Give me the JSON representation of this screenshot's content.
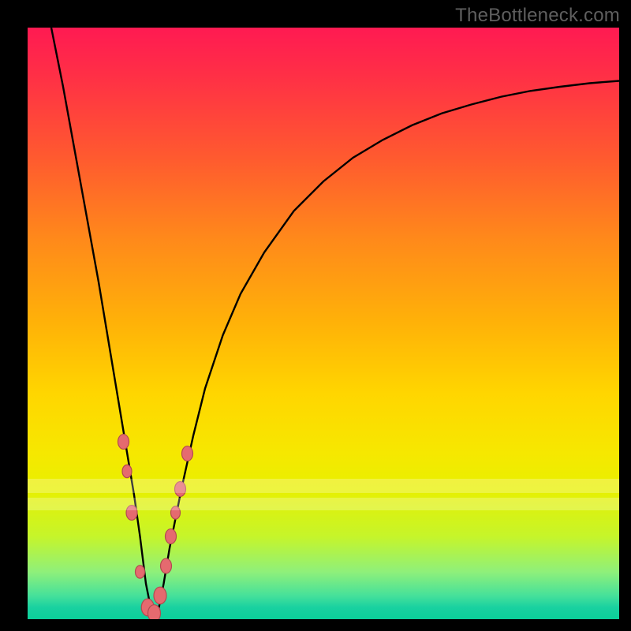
{
  "watermark": "TheBottleneck.com",
  "colors": {
    "frame": "#000000",
    "curve_stroke": "#000000",
    "marker_fill": "#e56a6f",
    "marker_stroke": "#b34a50",
    "gradient": [
      "#ff1a52",
      "#ff2f46",
      "#ff5a2f",
      "#ff8a1a",
      "#ffb208",
      "#ffd600",
      "#f6e800",
      "#e8f000",
      "#c6f52a",
      "#8ff07a",
      "#46e19a",
      "#19d1a0",
      "#0bcf99"
    ]
  },
  "chart_data": {
    "type": "line",
    "title": "",
    "xlabel": "",
    "ylabel": "",
    "xlim": [
      0,
      100
    ],
    "ylim": [
      0,
      100
    ],
    "series": [
      {
        "name": "bottleneck-curve",
        "x": [
          4,
          6,
          8,
          10,
          12,
          14,
          16,
          17,
          18,
          19,
          20,
          21,
          22,
          23,
          24,
          26,
          28,
          30,
          33,
          36,
          40,
          45,
          50,
          55,
          60,
          65,
          70,
          75,
          80,
          85,
          90,
          95,
          100
        ],
        "y": [
          100,
          90,
          79,
          68,
          57,
          45,
          33,
          27,
          21,
          14,
          6,
          1,
          1,
          6,
          12,
          22,
          31,
          39,
          48,
          55,
          62,
          69,
          74,
          78,
          81,
          83.5,
          85.5,
          87,
          88.3,
          89.3,
          90,
          90.6,
          91
        ]
      }
    ],
    "markers": {
      "name": "highlighted-points",
      "points": [
        {
          "x": 16.2,
          "y": 30,
          "r": 7
        },
        {
          "x": 16.8,
          "y": 25,
          "r": 6
        },
        {
          "x": 17.6,
          "y": 18,
          "r": 7
        },
        {
          "x": 19.0,
          "y": 8,
          "r": 6
        },
        {
          "x": 20.3,
          "y": 2,
          "r": 8
        },
        {
          "x": 21.4,
          "y": 1,
          "r": 8
        },
        {
          "x": 22.4,
          "y": 4,
          "r": 8
        },
        {
          "x": 23.4,
          "y": 9,
          "r": 7
        },
        {
          "x": 24.2,
          "y": 14,
          "r": 7
        },
        {
          "x": 25.0,
          "y": 18,
          "r": 6
        },
        {
          "x": 25.8,
          "y": 22,
          "r": 7
        },
        {
          "x": 27.0,
          "y": 28,
          "r": 7
        }
      ]
    },
    "haze_bands": [
      {
        "y_from": 22,
        "y_to": 24
      },
      {
        "y_from": 19,
        "y_to": 21
      }
    ]
  }
}
